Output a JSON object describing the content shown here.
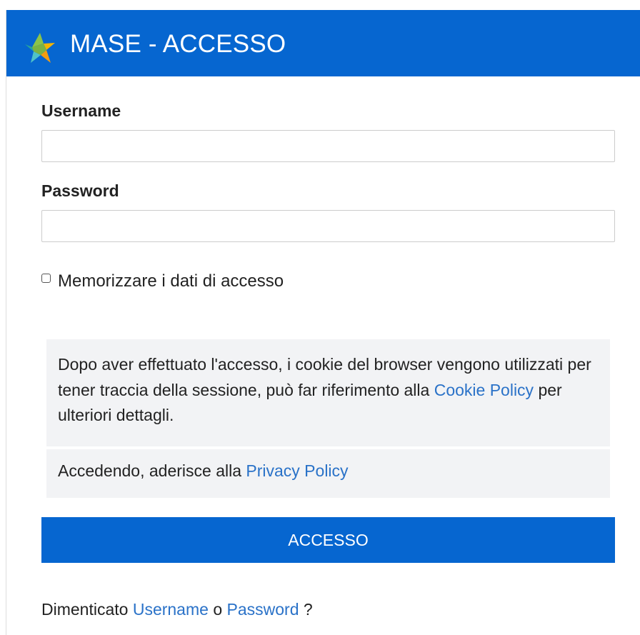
{
  "app": {
    "title": "MASE - ACCESSO",
    "logo_icon": "colored-star-logo-icon"
  },
  "colors": {
    "header_bg": "#0666d0",
    "button_bg": "#0666d0",
    "link": "#2a72c8",
    "notice_bg": "#f2f3f5"
  },
  "form": {
    "username_label": "Username",
    "username_value": "",
    "username_placeholder": "",
    "password_label": "Password",
    "password_value": "",
    "password_placeholder": "",
    "remember_label": "Memorizzare i dati di accesso",
    "remember_checked": false,
    "submit_label": "ACCESSO"
  },
  "notices": {
    "cookie_text_before": "Dopo aver effettuato l'accesso, i cookie del browser vengono utilizzati per tener traccia della sessione, può far riferimento alla ",
    "cookie_link": "Cookie Policy",
    "cookie_text_after": " per ulteriori dettagli.",
    "privacy_text_before": "Accedendo, aderisce alla ",
    "privacy_link": "Privacy Policy"
  },
  "recovery": {
    "prefix": "Dimenticato ",
    "username_link": "Username",
    "separator": " o ",
    "password_link": "Password",
    "suffix": " ?"
  }
}
